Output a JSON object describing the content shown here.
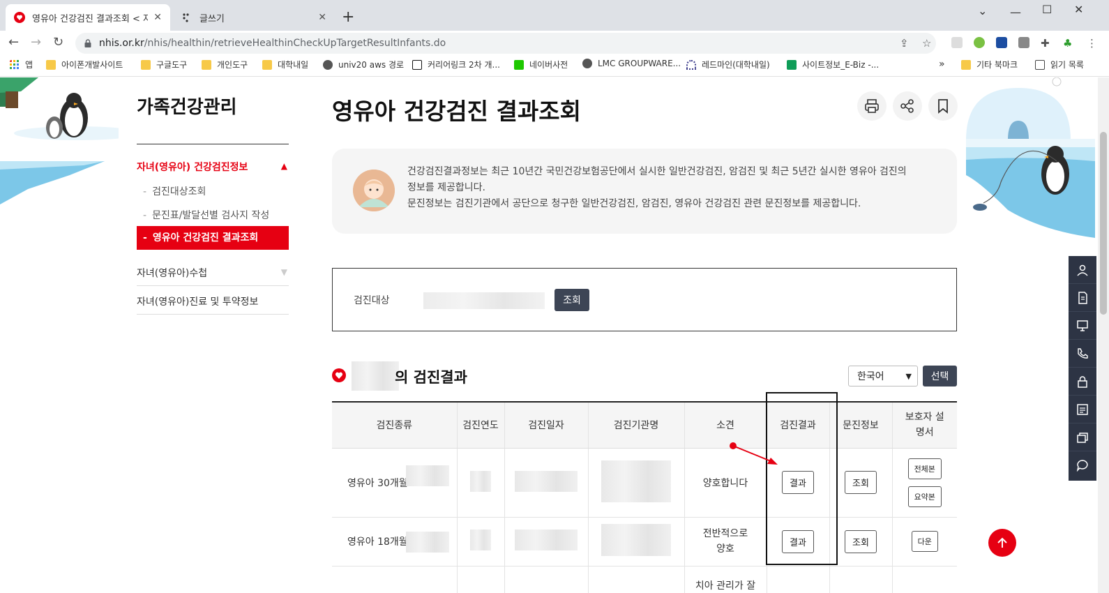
{
  "browser": {
    "tabs": [
      {
        "title": "영유아 건강검진 결과조회 < 자녀",
        "active": true
      },
      {
        "title": "글쓰기",
        "active": false
      }
    ],
    "url_host": "nhis.or.kr",
    "url_path": "/nhis/healthin/retrieveHealthinCheckUpTargetResultInfants.do",
    "bookmarks": [
      "앱",
      "아이폰개발사이트",
      "구글도구",
      "개인도구",
      "대학내일",
      "univ20 aws 경로",
      "커리어링크 2차 개...",
      "네이버사전",
      "LMC GROUPWARE...",
      "레드마인(대학내일)",
      "사이트정보_E-Biz -...",
      "»",
      "기타 북마크",
      "읽기 목록"
    ]
  },
  "sidebar": {
    "title": "가족건강관리",
    "sections": [
      {
        "label": "자녀(영유아) 건강검진정보",
        "active": true
      },
      {
        "label": "자녀(영유아)수첩",
        "active": false
      },
      {
        "label": "자녀(영유아)진료 및 투약정보",
        "active": false
      }
    ],
    "subitems": [
      {
        "label": "검진대상조회",
        "active": false
      },
      {
        "label": "문진표/발달선별 검사지 작성",
        "active": false
      },
      {
        "label": "영유아 건강검진 결과조회",
        "active": true
      }
    ]
  },
  "main": {
    "title": "영유아 건강검진 결과조회",
    "info_line1": "건강검진결과정보는 최근 10년간 국민건강보험공단에서 실시한 일반건강검진, 암검진 및 최근 5년간 실시한 영유아 검진의",
    "info_line2": "정보를 제공합니다.",
    "info_line3": "문진정보는 검진기관에서 공단으로 청구한 일반건강검진, 암검진, 영유아 건강검진 관련 문진정보를 제공합니다.",
    "search_label": "검진대상",
    "search_button": "조회",
    "result_title": "의 검진결과",
    "lang_value": "한국어",
    "lang_button": "선택"
  },
  "table": {
    "headers": [
      "검진종류",
      "검진연도",
      "검진일자",
      "검진기관명",
      "소견",
      "검진결과",
      "문진정보",
      "보호자 설명서"
    ],
    "rows": [
      {
        "type": "영유아 30개월",
        "opinion": "양호합니다",
        "result_btn": "결과",
        "inquiry_btn": "조회",
        "guide_btns": [
          "전체본",
          "요약본"
        ]
      },
      {
        "type": "영유아 18개월",
        "opinion": "전반적으로 양호",
        "result_btn": "결과",
        "inquiry_btn": "조회",
        "guide_btns": [
          "다운"
        ]
      },
      {
        "type": "",
        "opinion": "치아 관리가 잘",
        "result_btn": "",
        "inquiry_btn": "",
        "guide_btns": []
      }
    ]
  },
  "colors": {
    "accent": "#e60012",
    "dark_button": "#3d4555",
    "rail": "#2d3444"
  }
}
